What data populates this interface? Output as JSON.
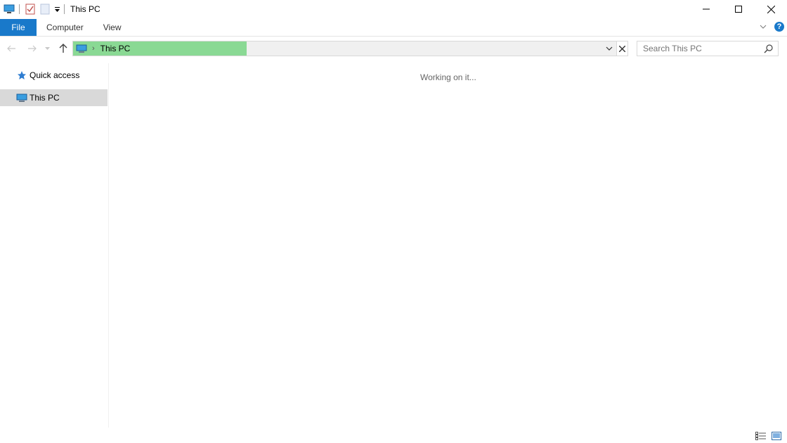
{
  "window": {
    "title": "This PC",
    "icons": [
      "computer-icon",
      "properties-icon",
      "new-folder-icon",
      "customize-qat-icon"
    ],
    "controls": [
      "minimize-icon",
      "maximize-icon",
      "close-icon"
    ]
  },
  "ribbon": {
    "tabs": [
      {
        "label": "File"
      },
      {
        "label": "Computer"
      },
      {
        "label": "View"
      }
    ],
    "accent_color": "#1979ca",
    "help_label": "?"
  },
  "nav": {
    "back_icon": "back-arrow-icon",
    "forward_icon": "forward-arrow-icon",
    "recent_icon": "chevron-down-icon",
    "up_icon": "up-arrow-icon"
  },
  "address": {
    "crumb_separator": "›",
    "crumb": "This PC",
    "progress_color": "#8ad994",
    "progress_fraction": 0.32
  },
  "search": {
    "placeholder": "Search This PC"
  },
  "sidebar": {
    "items": [
      {
        "label": "Quick access",
        "icon": "star-icon",
        "selected": false
      },
      {
        "label": "This PC",
        "icon": "computer-icon",
        "selected": true
      }
    ],
    "selected_bg": "#d9d9d9"
  },
  "content": {
    "status_text": "Working on it..."
  },
  "statusbar": {
    "views": [
      "details-view-icon",
      "large-icons-view-icon"
    ]
  }
}
